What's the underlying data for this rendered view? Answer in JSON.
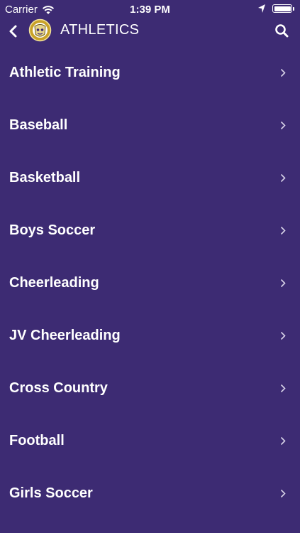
{
  "status_bar": {
    "carrier": "Carrier",
    "time": "1:39 PM"
  },
  "nav": {
    "title": "ATHLETICS",
    "back_icon": "chevron-left-icon",
    "search_icon": "search-icon"
  },
  "colors": {
    "background": "#3d2b73",
    "text": "#ffffff"
  },
  "list": {
    "items": [
      {
        "label": "Athletic Training"
      },
      {
        "label": "Baseball"
      },
      {
        "label": "Basketball"
      },
      {
        "label": "Boys Soccer"
      },
      {
        "label": "Cheerleading"
      },
      {
        "label": "JV Cheerleading"
      },
      {
        "label": "Cross Country"
      },
      {
        "label": "Football"
      },
      {
        "label": "Girls Soccer"
      }
    ]
  }
}
